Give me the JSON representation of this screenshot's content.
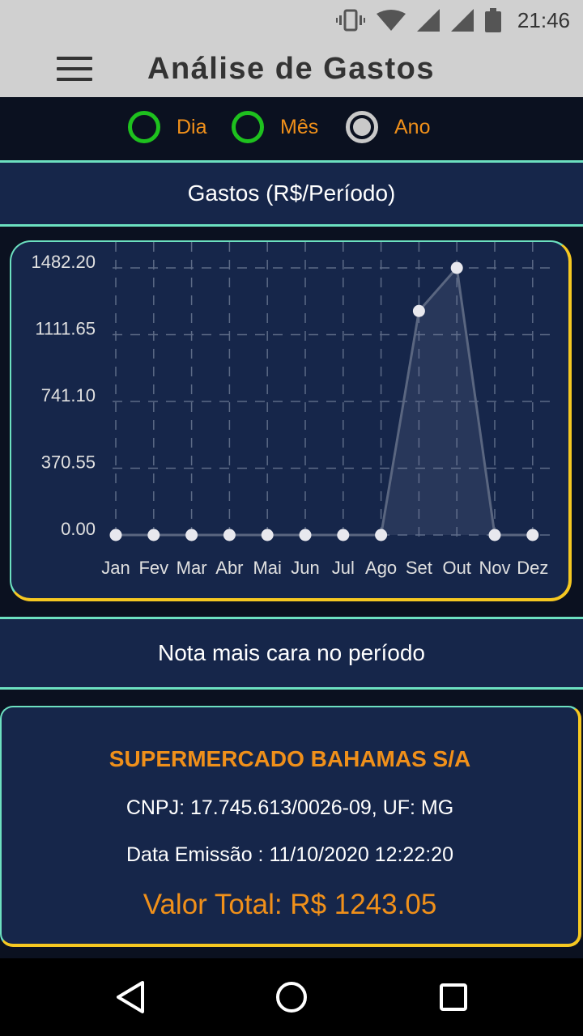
{
  "status_bar": {
    "time": "21:46",
    "icons": [
      "vibrate-icon",
      "wifi-icon",
      "signal-icon",
      "signal-icon",
      "battery-icon"
    ]
  },
  "app_bar": {
    "title": "Análise de Gastos",
    "menu_icon": "hamburger-menu-icon"
  },
  "period_selector": {
    "options": [
      {
        "label": "Dia",
        "selected": false
      },
      {
        "label": "Mês",
        "selected": false
      },
      {
        "label": "Ano",
        "selected": true
      }
    ]
  },
  "chart_section": {
    "header": "Gastos (R$/Período)"
  },
  "chart_data": {
    "type": "line",
    "categories": [
      "Jan",
      "Fev",
      "Mar",
      "Abr",
      "Mai",
      "Jun",
      "Jul",
      "Ago",
      "Set",
      "Out",
      "Nov",
      "Dez"
    ],
    "values": [
      0,
      0,
      0,
      0,
      0,
      0,
      0,
      0,
      1243.05,
      1482.2,
      0,
      0
    ],
    "y_ticks": [
      "1482.20",
      "1111.65",
      "741.10",
      "370.55",
      "0.00"
    ],
    "ylim": [
      0,
      1482.2
    ],
    "grid": true,
    "colors": {
      "line": "#5a6680",
      "point": "#e8e8ee",
      "grid": "#5c6a86",
      "text": "#e0e0e0"
    }
  },
  "note_section": {
    "header": "Nota mais cara no período",
    "company": "SUPERMERCADO BAHAMAS S/A",
    "cnpj_line": "CNPJ: 17.745.613/0026-09, UF: MG",
    "date_line": "Data Emissão : 11/10/2020 12:22:20",
    "total_line": "Valor Total: R$ 1243.05"
  },
  "nav_bar": {
    "buttons": [
      "back-icon",
      "home-icon",
      "recents-icon"
    ]
  },
  "colors": {
    "app_bar": "#d0d0d0",
    "background": "#0b1120",
    "panel": "#16264a",
    "accent_teal": "#6ce0c0",
    "accent_yellow": "#f6c821",
    "accent_orange": "#f0901a",
    "radio_green": "#1ec11e"
  }
}
